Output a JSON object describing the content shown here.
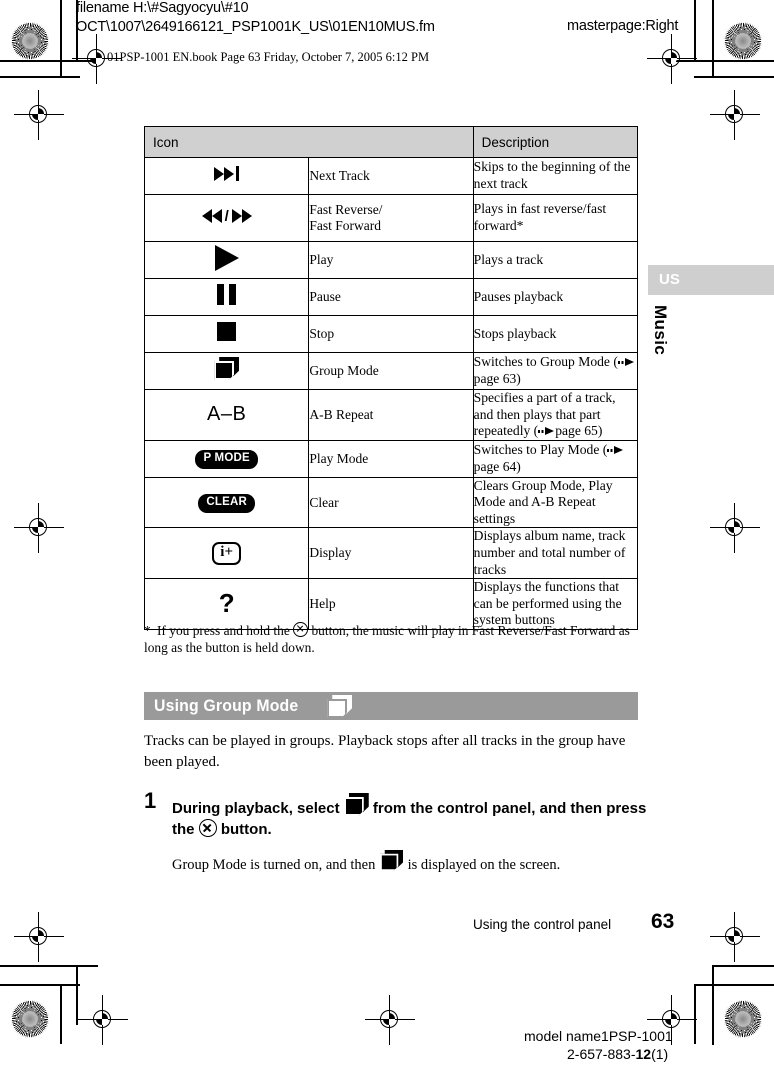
{
  "prepress": {
    "filename_line1": "filename H:\\#Sagyocyu\\#10",
    "filename_line2": "OCT\\1007\\2649166121_PSP1001K_US\\01EN10MUS.fm",
    "masterpage": "masterpage:Right",
    "bookline": "01PSP-1001 EN.book  Page 63  Friday, October 7, 2005  6:12 PM"
  },
  "table": {
    "headers": [
      "Icon",
      "Description"
    ],
    "rows": [
      {
        "icon": "next-track-icon",
        "name": "Next Track",
        "desc": "Skips to the beginning of the next track"
      },
      {
        "icon": "fast-rev-fwd-icon",
        "name": "Fast Reverse/\nFast Forward",
        "desc": "Plays in fast reverse/fast forward*"
      },
      {
        "icon": "play-icon",
        "name": "Play",
        "desc": "Plays a track"
      },
      {
        "icon": "pause-icon",
        "name": "Pause",
        "desc": "Pauses playback"
      },
      {
        "icon": "stop-icon",
        "name": "Stop",
        "desc": "Stops playback"
      },
      {
        "icon": "group-mode-icon",
        "name": "Group Mode",
        "desc_pre": "Switches to Group Mode (",
        "desc_post": "page 63)"
      },
      {
        "icon": "ab-repeat-icon",
        "name": "A-B Repeat",
        "desc_pre": "Specifies a part of a track, and then plays that part repeatedly (",
        "desc_post": "page 65)",
        "icon_label": "A–B"
      },
      {
        "icon": "play-mode-icon",
        "name": "Play Mode",
        "desc_pre": "Switches to Play Mode (",
        "desc_post": "page 64)",
        "icon_label": "P MODE"
      },
      {
        "icon": "clear-icon",
        "name": "Clear",
        "desc": "Clears Group Mode, Play Mode and A-B Repeat settings",
        "icon_label": "CLEAR"
      },
      {
        "icon": "display-icon",
        "name": "Display",
        "desc": "Displays album name, track number and total number of tracks",
        "icon_label": "i+"
      },
      {
        "icon": "help-icon",
        "name": "Help",
        "desc": "Displays the functions that can be performed using the system buttons",
        "icon_label": "?"
      }
    ]
  },
  "footnote": {
    "marker": "*",
    "part1": "If you press and hold the",
    "part2": "button, the music will play in Fast Reverse/Fast Forward as long as the button is held down."
  },
  "section": {
    "title": "Using Group Mode",
    "intro": "Tracks can be played in groups. Playback stops after all tracks in the group have been played.",
    "step_number": "1",
    "step_part1": "During playback, select",
    "step_part2": "from the control panel, and then press the",
    "step_part3": "button.",
    "step_sub_part1": "Group Mode is turned on, and then",
    "step_sub_part2": "is displayed on the screen."
  },
  "sidebar": {
    "region_tab": "US",
    "chapter": "Music"
  },
  "footer": {
    "caption": "Using the control panel",
    "page_number": "63",
    "model_name": "model name1PSP-1001",
    "doc_number_pre": "2-657-883-",
    "doc_number_bold": "12",
    "doc_number_post": "(1)"
  },
  "colors": {
    "header_fill": "#d0d0d0",
    "section_bar": "#9a9a9a",
    "tab_fill": "#cfcfcf",
    "rule": "#000000"
  }
}
